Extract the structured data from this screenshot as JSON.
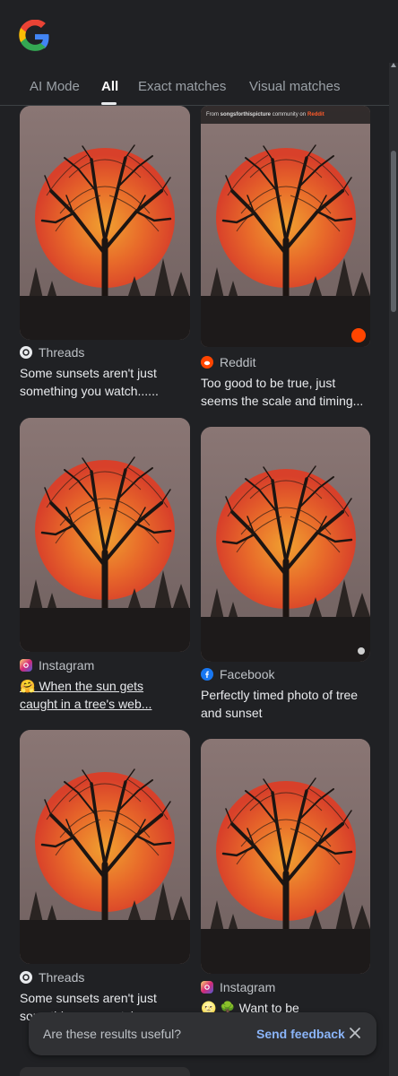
{
  "tabs": [
    {
      "label": "AI Mode"
    },
    {
      "label": "All"
    },
    {
      "label": "Exact matches"
    },
    {
      "label": "Visual matches"
    }
  ],
  "results": [
    {
      "source": "Threads",
      "icon": "threads-icon",
      "caption_line1": "Some sunsets aren't just",
      "caption_line2": "something you watch......"
    },
    {
      "source": "Reddit",
      "icon": "reddit-icon",
      "caption_line1": "Too good to be true, just",
      "caption_line2": "seems the scale and timing...",
      "banner_prefix": "From",
      "banner_community": "songsforthispicture",
      "banner_mid": "community on",
      "banner_site": "Reddit"
    },
    {
      "source": "Instagram",
      "icon": "instagram-icon",
      "caption_line1": "🤗 When the sun gets",
      "caption_line2": "caught in a tree's web..."
    },
    {
      "source": "Facebook",
      "icon": "facebook-icon",
      "caption_line1": "Perfectly timed photo of tree",
      "caption_line2": "and sunset"
    },
    {
      "source": "Threads",
      "icon": "threads-icon",
      "caption_line1": "Some sunsets aren't just",
      "caption_line2": "something you watch......"
    },
    {
      "source": "Instagram",
      "icon": "instagram-icon",
      "caption_line1": "🌝 🌳 Want to be",
      "caption_line2": ""
    }
  ],
  "feedback": {
    "question": "Are these results useful?",
    "button": "Send feedback"
  },
  "colors": {
    "background": "#202124",
    "accent_link": "#8ab4f8",
    "sun": "#e0502a",
    "sky": "#7d6a68"
  }
}
